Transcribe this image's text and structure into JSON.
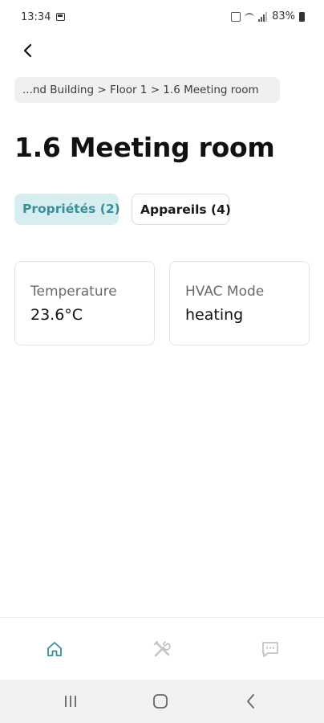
{
  "status_bar": {
    "time": "13:34",
    "battery": "83%"
  },
  "breadcrumb": {
    "text": "...nd Building > Floor 1 > 1.6 Meeting room"
  },
  "page": {
    "title": "1.6 Meeting room"
  },
  "tabs": [
    {
      "label": "Propriétés (2)",
      "active": true
    },
    {
      "label": "Appareils (4)",
      "active": false
    }
  ],
  "properties": [
    {
      "label": "Temperature",
      "value": "23.6°C"
    },
    {
      "label": "HVAC Mode",
      "value": "heating"
    }
  ],
  "bottom_nav": {
    "items": [
      {
        "icon": "home-icon",
        "active": true
      },
      {
        "icon": "tools-icon",
        "active": false
      },
      {
        "icon": "chat-icon",
        "active": false
      }
    ]
  },
  "colors": {
    "accent": "#3a8e9a",
    "active_tab_bg": "#d7eef0",
    "breadcrumb_bg": "#eef0f2",
    "inactive_icon": "#c4c4c4"
  }
}
